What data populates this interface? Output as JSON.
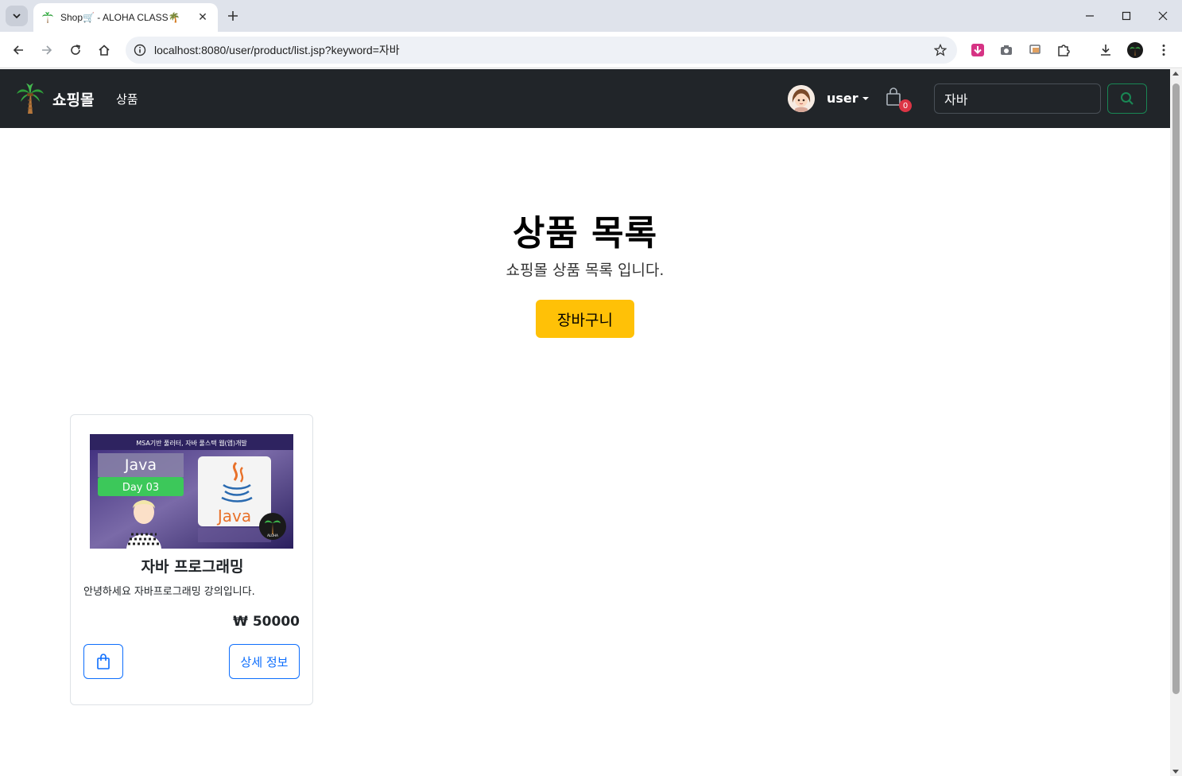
{
  "browser": {
    "tab_title": "Shop🛒 - ALOHA CLASS🌴",
    "url": "localhost:8080/user/product/list.jsp?keyword=자바"
  },
  "navbar": {
    "brand": "쇼핑몰",
    "products_link": "상품",
    "user_name": "user",
    "cart_count": "0",
    "search_value": "자바"
  },
  "hero": {
    "title": "상품 목록",
    "subtitle": "쇼핑몰 상품 목록 입니다.",
    "cart_button": "장바구니"
  },
  "products": [
    {
      "image": {
        "banner": "MSA기반 풀러터, 자바 풀스택 웹(앱)개발",
        "course": "Java",
        "day": "Day 03",
        "logo": "Java",
        "badge": "ALOHA"
      },
      "title": "자바 프로그래밍",
      "description": "안녕하세요 자바프로그래밍 강의입니다.",
      "price": "₩ 50000",
      "detail_button": "상세 정보"
    }
  ],
  "colors": {
    "navbar_bg": "#212529",
    "warning": "#ffc107",
    "primary": "#0d6efd",
    "success": "#198754",
    "danger": "#dc3545"
  }
}
